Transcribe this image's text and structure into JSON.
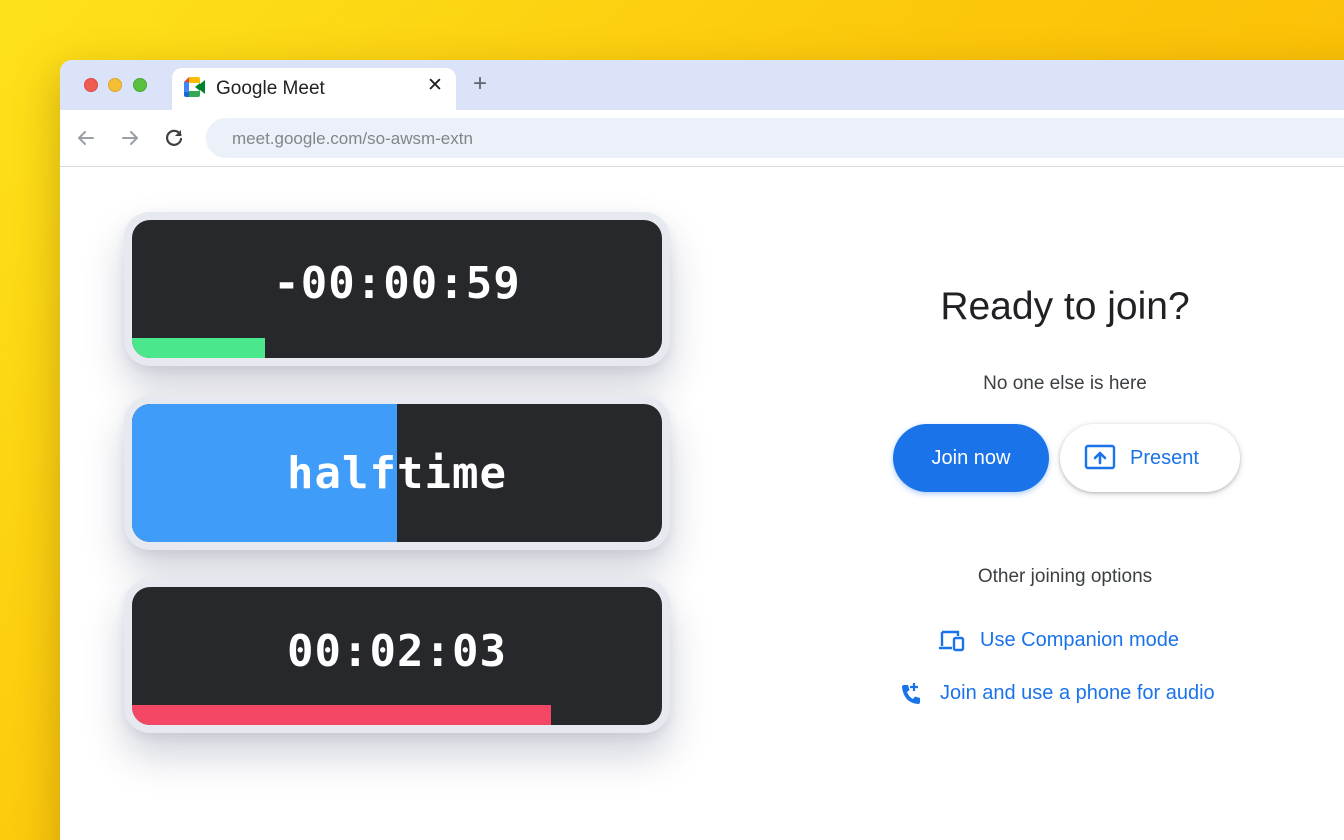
{
  "browser": {
    "tab_title": "Google Meet",
    "tab_icon": "google-meet-icon",
    "close_glyph": "✕",
    "new_tab_glyph": "+",
    "url": "meet.google.com/so-awsm-extn"
  },
  "timers": [
    {
      "text": "-00:00:59",
      "progress": 0.25,
      "bar_color": "#4ae78d",
      "style": "bottom-bar"
    },
    {
      "text": "halftime",
      "progress": 0.5,
      "bar_color": "#409cf9",
      "style": "half-fill"
    },
    {
      "text": "00:02:03",
      "progress": 0.79,
      "bar_color": "#f44766",
      "style": "bottom-bar"
    }
  ],
  "meet": {
    "title": "Ready to join?",
    "status": "No one else is here",
    "join_label": "Join now",
    "present_label": "Present",
    "present_icon": "present-screen-icon",
    "other_options_title": "Other joining options",
    "companion_label": "Use Companion mode",
    "companion_icon": "companion-devices-icon",
    "phone_label": "Join and use a phone for audio",
    "phone_icon": "phone-add-icon"
  },
  "colors": {
    "accent": "#1a73e8",
    "timer_background": "#27282c"
  }
}
